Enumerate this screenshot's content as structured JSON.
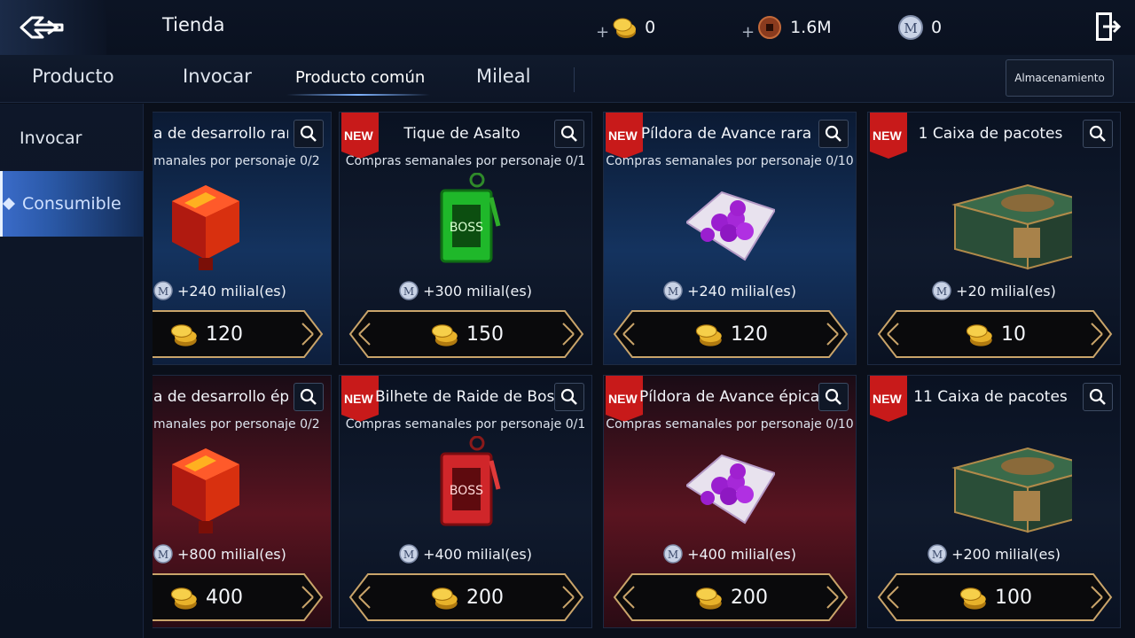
{
  "header": {
    "title": "Tienda",
    "currencies": [
      {
        "icon": "gold-coin-icon",
        "value": "0",
        "has_plus": true
      },
      {
        "icon": "copper-coin-icon",
        "value": "1.6M",
        "has_plus": true
      },
      {
        "icon": "mileage-icon",
        "value": "0",
        "has_plus": false
      }
    ]
  },
  "tabs": [
    {
      "label": "Producto",
      "active": false
    },
    {
      "label": "Invocar",
      "active": false
    },
    {
      "label": "Producto común",
      "active": true
    },
    {
      "label": "Mileal",
      "active": false
    }
  ],
  "storage_label": "Almacenamiento",
  "sidebar": [
    {
      "label": "Invocar",
      "active": false
    },
    {
      "label": "Consumible",
      "active": true
    }
  ],
  "badge_label": "NEW",
  "products": [
    {
      "name": "a de desarrollo rara",
      "limit": "manales por personaje 0/2",
      "mileage": "+240 milial(es)",
      "price": "120",
      "theme": "blue",
      "art": "red-cube",
      "new": false
    },
    {
      "name": "Tique de Asalto",
      "limit": "Compras semanales por personaje 0/1",
      "mileage": "+300 milial(es)",
      "price": "150",
      "theme": "dark",
      "art": "green-tag",
      "new": true
    },
    {
      "name": "Píldora de Avance rara",
      "limit": "Compras semanales por personaje 0/10",
      "mileage": "+240 milial(es)",
      "price": "120",
      "theme": "blue",
      "art": "pills",
      "new": true
    },
    {
      "name": "1 Caixa de pacotes",
      "limit": "",
      "mileage": "+20 milial(es)",
      "price": "10",
      "theme": "dark",
      "art": "chest",
      "new": true
    },
    {
      "name": "a de desarrollo épica",
      "limit": "manales por personaje 0/2",
      "mileage": "+800 milial(es)",
      "price": "400",
      "theme": "red",
      "art": "red-cube",
      "new": false
    },
    {
      "name": "Bilhete de Raide de Boss",
      "limit": "Compras semanales por personaje 0/1",
      "mileage": "+400 milial(es)",
      "price": "200",
      "theme": "dark",
      "art": "red-tag",
      "new": true
    },
    {
      "name": "Píldora de Avance épica",
      "limit": "Compras semanales por personaje 0/10",
      "mileage": "+400 milial(es)",
      "price": "200",
      "theme": "red",
      "art": "pills",
      "new": true
    },
    {
      "name": "11 Caixa de pacotes",
      "limit": "",
      "mileage": "+200 milial(es)",
      "price": "100",
      "theme": "dark",
      "art": "chest",
      "new": true
    }
  ]
}
